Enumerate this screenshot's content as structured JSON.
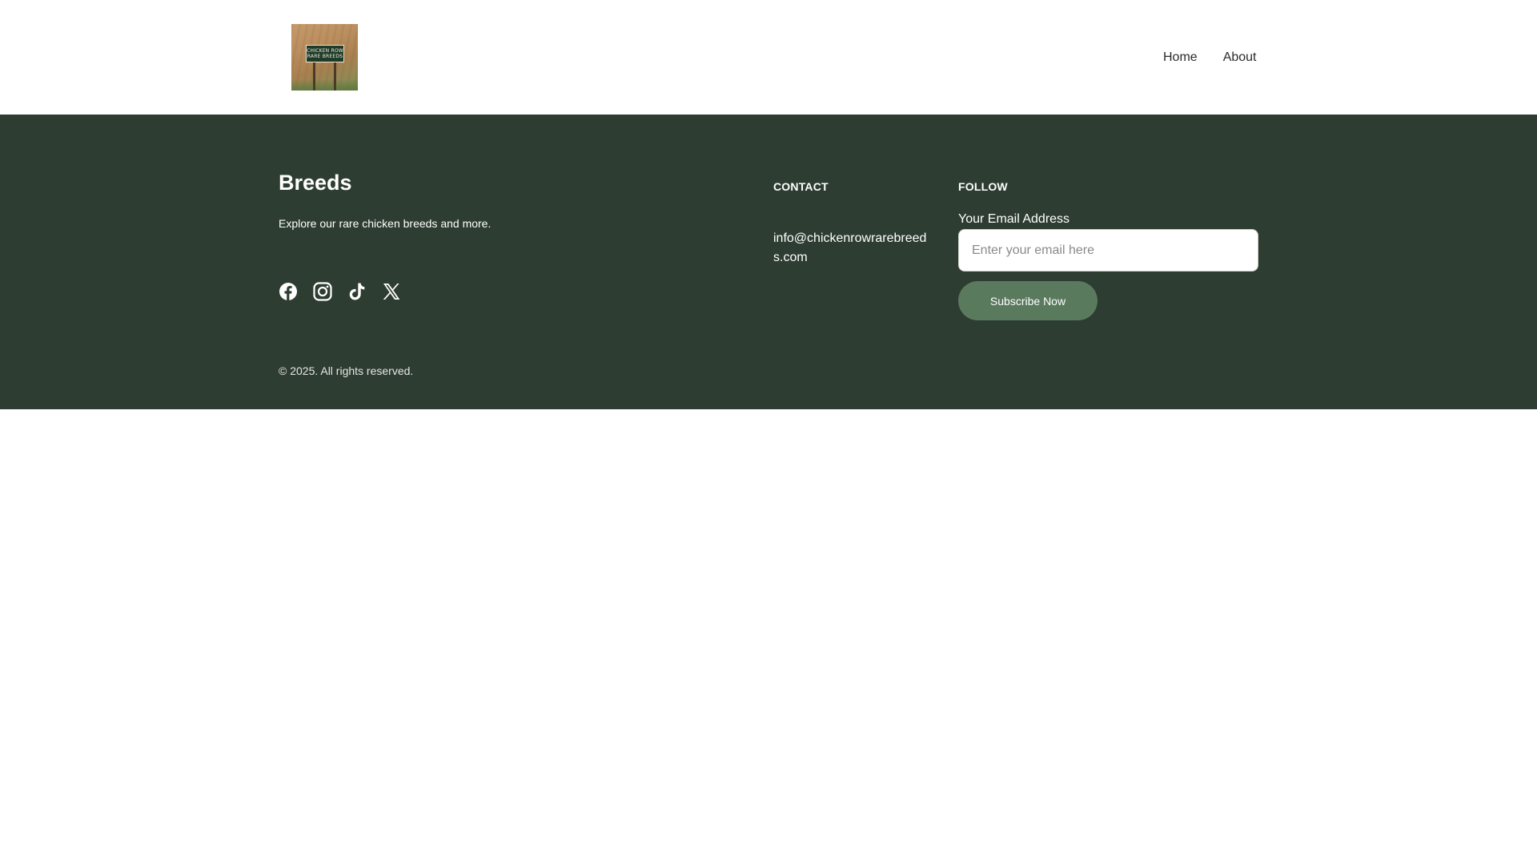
{
  "header": {
    "logo_text_line1": "CHICKEN ROW",
    "logo_text_line2": "RARE BREEDS",
    "nav": [
      {
        "label": "Home"
      },
      {
        "label": "About"
      }
    ]
  },
  "footer": {
    "brand": {
      "title": "Breeds",
      "tagline": "Explore our rare chicken breeds and more."
    },
    "socials": [
      {
        "icon": "facebook-icon"
      },
      {
        "icon": "instagram-icon"
      },
      {
        "icon": "tiktok-icon"
      },
      {
        "icon": "x-icon"
      }
    ],
    "contact": {
      "heading": "CONTACT",
      "email": "info@chickenrowrarebreeds.com"
    },
    "follow": {
      "heading": "FOLLOW",
      "email_label": "Your Email Address",
      "email_placeholder": "Enter your email here",
      "email_value": "",
      "subscribe_label": "Subscribe Now"
    },
    "copyright": "© 2025. All rights reserved."
  },
  "colors": {
    "footer_bg": "#2e3d31",
    "button_bg": "#5a7a5e",
    "text_light": "#ffffff",
    "nav_text": "#2a2a2a"
  }
}
